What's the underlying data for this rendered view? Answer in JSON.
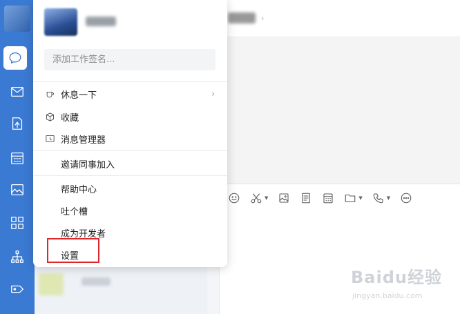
{
  "popup": {
    "signature_placeholder": "添加工作签名...",
    "menu": [
      {
        "label": "休息一下",
        "icon": "coffee-cup-icon",
        "has_submenu": true
      },
      {
        "label": "收藏",
        "icon": "box-icon"
      },
      {
        "label": "消息管理器",
        "icon": "message-manager-icon"
      },
      {
        "label": "邀请同事加入"
      },
      {
        "label": "帮助中心"
      },
      {
        "label": "吐个槽"
      },
      {
        "label": "成为开发者"
      },
      {
        "label": "设置",
        "highlighted": true
      }
    ]
  },
  "sidebar": {
    "icons": [
      "chat-icon",
      "mail-icon",
      "docs-icon",
      "calendar-icon",
      "photos-icon",
      "apps-icon",
      "org-chart-icon",
      "tag-icon"
    ],
    "active": "chat-icon"
  },
  "chat": {
    "toolbar": [
      "emoji-icon",
      "scissors-icon",
      "image-icon",
      "document-icon",
      "calendar-icon",
      "folder-icon",
      "phone-icon",
      "more-icon"
    ]
  },
  "watermark": {
    "brand": "Baidu经验",
    "url": "jingyan.baidu.com"
  },
  "colors": {
    "rail": "#3b7ad3",
    "highlight_border": "#e0262b"
  }
}
